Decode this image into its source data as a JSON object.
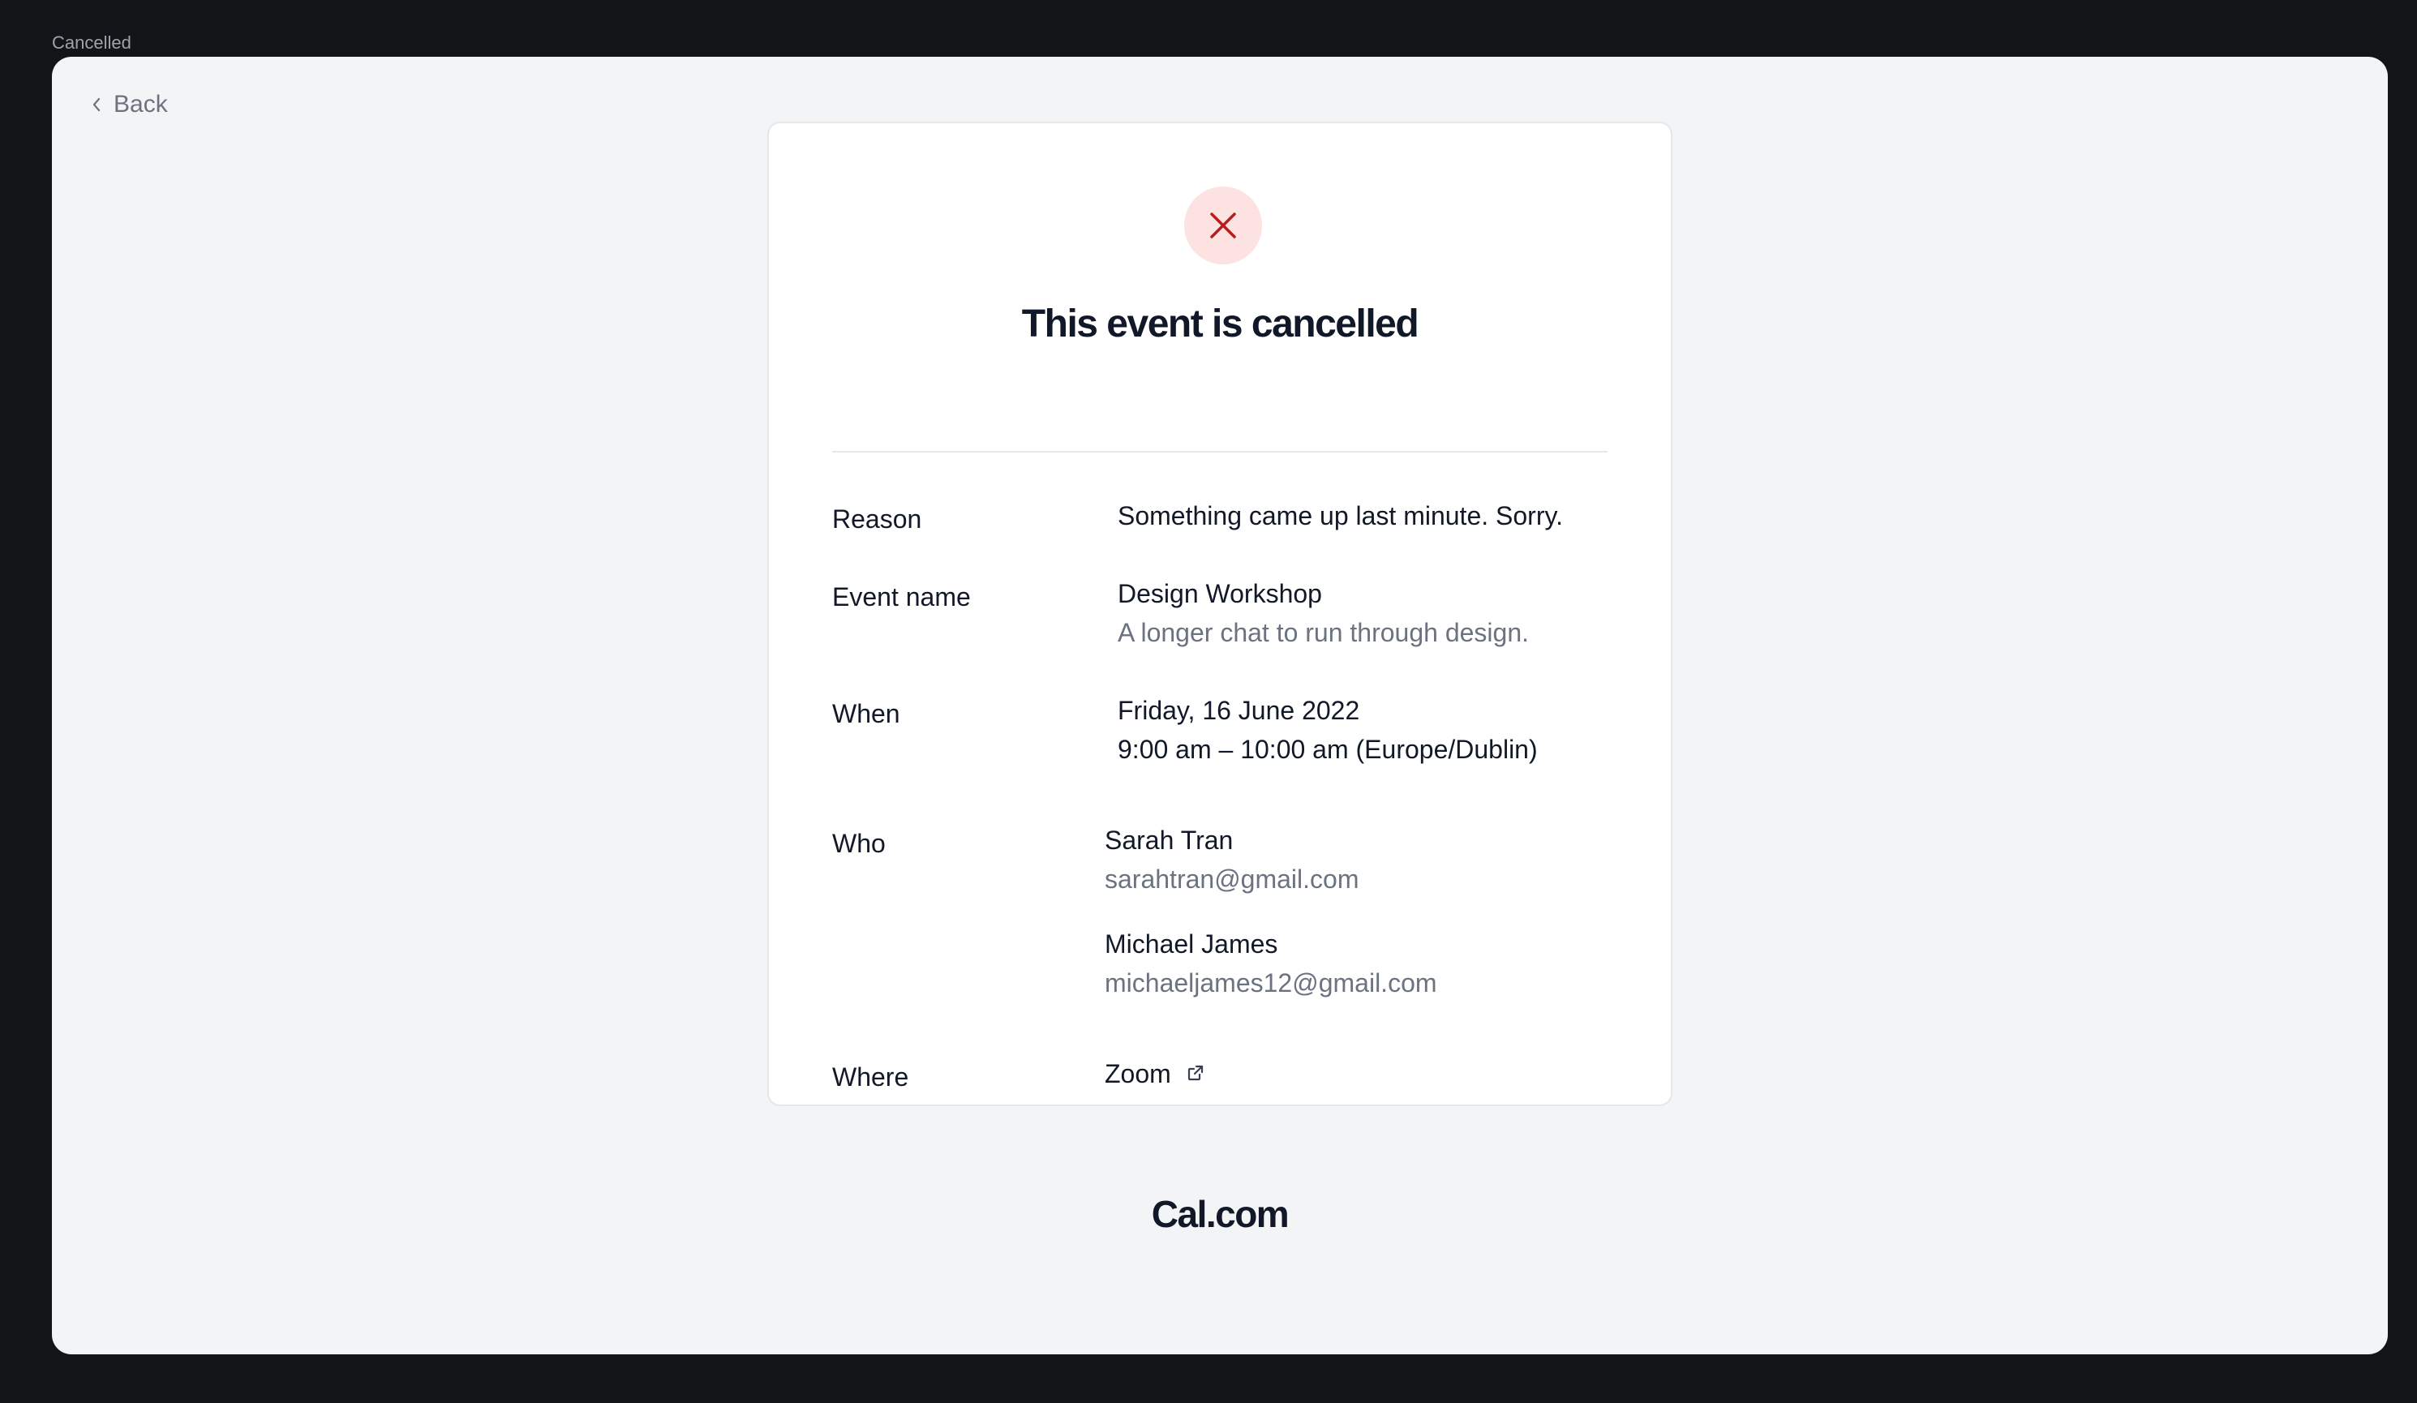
{
  "window": {
    "label": "Cancelled"
  },
  "nav": {
    "back_label": "Back"
  },
  "card": {
    "status_icon": "close-x-icon",
    "title": "This event is cancelled",
    "details": {
      "reason": {
        "label": "Reason",
        "value": "Something came up last minute. Sorry."
      },
      "event_name": {
        "label": "Event name",
        "name": "Design Workshop",
        "description": "A longer chat to run through design."
      },
      "when": {
        "label": "When",
        "date": "Friday, 16 June 2022",
        "time": "9:00 am – 10:00 am (Europe/Dublin)"
      },
      "who": {
        "label": "Who",
        "attendees": [
          {
            "name": "Sarah Tran",
            "email": "sarahtran@gmail.com"
          },
          {
            "name": "Michael James",
            "email": "michaeljames12@gmail.com"
          }
        ]
      },
      "where": {
        "label": "Where",
        "value": "Zoom",
        "icon": "external-link-icon"
      }
    }
  },
  "footer": {
    "brand": "Cal.com"
  },
  "colors": {
    "outer_background": "#131418",
    "frame_background": "#f3f4f6",
    "card_background": "#ffffff",
    "status_circle": "#fde2e2",
    "status_x": "#b91c1c",
    "text_primary": "#111827",
    "text_muted": "#6b7280"
  }
}
